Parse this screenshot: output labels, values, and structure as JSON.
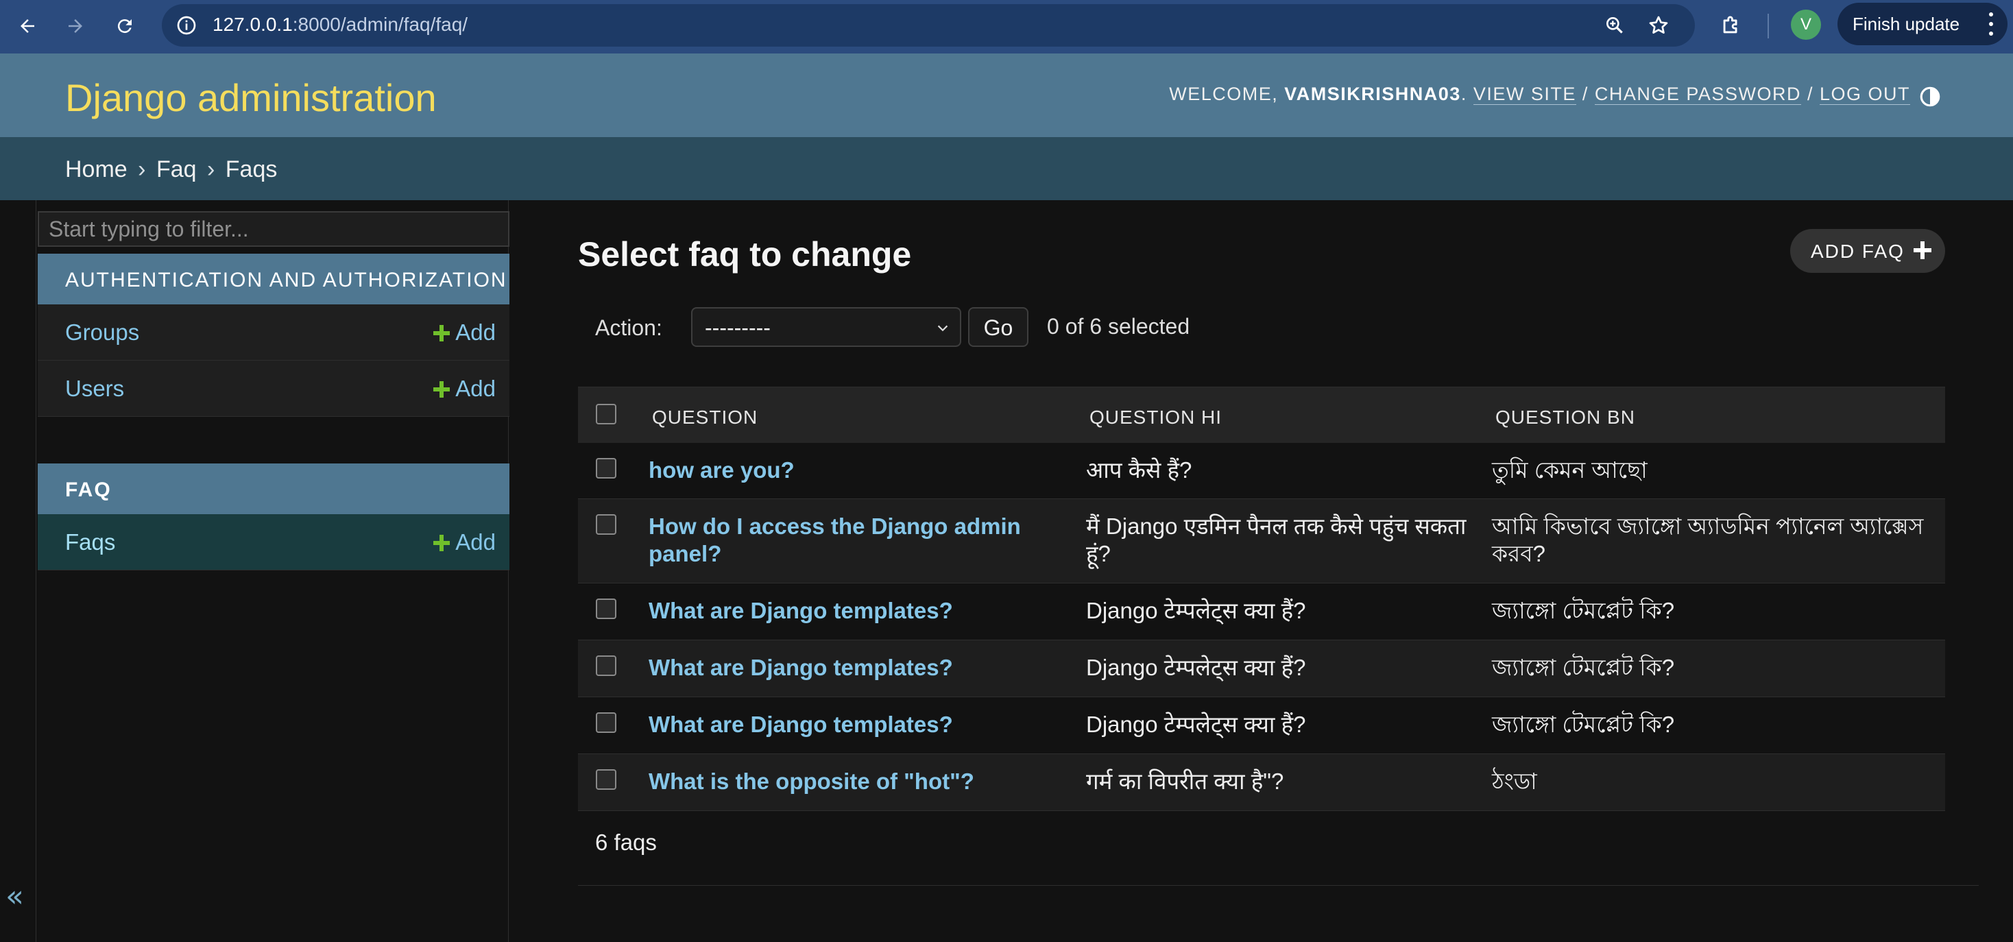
{
  "browser": {
    "url_host": "127.0.0.1",
    "url_path": ":8000/admin/faq/faq/",
    "profile_initial": "V",
    "finish_update_label": "Finish update",
    "icons": [
      "back-icon",
      "forward-icon",
      "reload-icon",
      "site-info-icon",
      "zoom-icon",
      "bookmark-star-icon",
      "extensions-icon",
      "more-menu-icon"
    ]
  },
  "header": {
    "site_name": "Django administration",
    "welcome": "WELCOME,",
    "username": "VAMSIKRISHNA03",
    "view_site": "VIEW SITE",
    "change_password": "CHANGE PASSWORD",
    "log_out": "LOG OUT",
    "separator": "/"
  },
  "breadcrumbs": {
    "home": "Home",
    "app": "Faq",
    "model": "Faqs",
    "separator": "›"
  },
  "sidebar": {
    "filter_placeholder": "Start typing to filter...",
    "collapse_label": "«",
    "apps": [
      {
        "name": "AUTHENTICATION AND AUTHORIZATION",
        "models": [
          {
            "name": "Groups",
            "add_label": "Add"
          },
          {
            "name": "Users",
            "add_label": "Add"
          }
        ]
      },
      {
        "name": "FAQ",
        "models": [
          {
            "name": "Faqs",
            "add_label": "Add"
          }
        ]
      }
    ]
  },
  "main": {
    "title": "Select faq to change",
    "add_button": "ADD FAQ",
    "action_label": "Action:",
    "action_selected": "---------",
    "go_label": "Go",
    "selected_count": "0 of 6 selected",
    "columns": [
      "QUESTION",
      "QUESTION HI",
      "QUESTION BN"
    ],
    "rows": [
      {
        "question": "how are you?",
        "question_hi": "आप कैसे हैं?",
        "question_bn": "তুমি কেমন আছো"
      },
      {
        "question": "How do I access the Django admin panel?",
        "question_hi": "मैं Django एडमिन पैनल तक कैसे पहुंच सकता हूं?",
        "question_bn": "আমি কিভাবে জ্যাঙ্গো অ্যাডমিন প্যানেল অ্যাক্সেস করব?"
      },
      {
        "question": "What are Django templates?",
        "question_hi": "Django टेम्पलेट्स क्या हैं?",
        "question_bn": "জ্যাঙ্গো টেমপ্লেট কি?"
      },
      {
        "question": "What are Django templates?",
        "question_hi": "Django टेम्पलेट्स क्या हैं?",
        "question_bn": "জ্যাঙ্গো টেমপ্লেট কি?"
      },
      {
        "question": "What are Django templates?",
        "question_hi": "Django टेम्पलेट्स क्या हैं?",
        "question_bn": "জ্যাঙ্গো টেমপ্লেট কি?"
      },
      {
        "question": "What is the opposite of \"hot\"?",
        "question_hi": "गर्म का विपरीत क्या है\"?",
        "question_bn": "ঠংডা"
      }
    ],
    "paginator": "6 faqs"
  },
  "colors": {
    "chrome_bg": "#2b4b7e",
    "header_bg": "#4f7791",
    "breadcrumb_bg": "#2b4c5d",
    "site_name": "#f5dd5d",
    "link": "#86c6e8",
    "add_green": "#70bf2b",
    "page_bg": "#121212"
  }
}
